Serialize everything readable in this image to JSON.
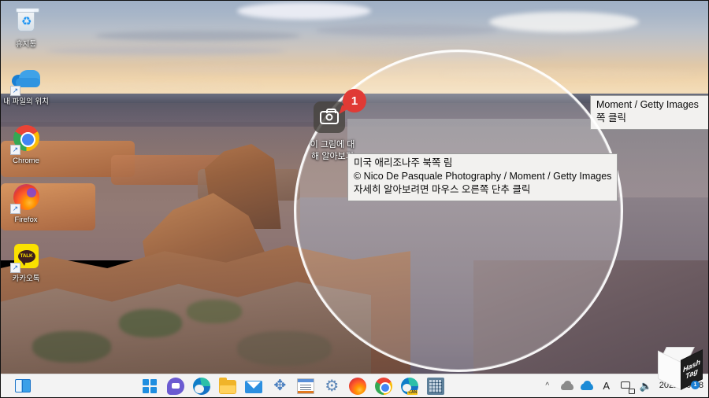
{
  "desktop": {
    "icons": [
      {
        "label": "휴지통",
        "icon": "recycle-bin-icon",
        "name": "desktop-icon-recycle-bin",
        "shortcut": false
      },
      {
        "label": "내 파일의 위치",
        "icon": "onedrive-icon",
        "name": "desktop-icon-onedrive",
        "shortcut": true
      },
      {
        "label": "Chrome",
        "icon": "chrome-icon",
        "name": "desktop-icon-chrome",
        "shortcut": true
      },
      {
        "label": "Firefox",
        "icon": "firefox-icon",
        "name": "desktop-icon-firefox",
        "shortcut": true
      },
      {
        "label": "카카오톡",
        "icon": "kakaotalk-icon",
        "name": "desktop-icon-kakaotalk",
        "shortcut": true
      }
    ],
    "wallpaper_description": "Grand Canyon North Rim at sunset"
  },
  "spotlight": {
    "badge_number": "1",
    "button_icon": "camera-icon",
    "learn_label": "이 그림에 대해 알아보기",
    "highlight_shape": "circle",
    "accent_color": "#e03a35",
    "button_color": "#484440"
  },
  "tooltip": {
    "line1": "미국 애리조나주 북쪽 림",
    "line2": "© Nico De Pasquale Photography / Moment / Getty Images",
    "line3": "자세히 알아보려면 마우스 오른쪽 단추 클릭",
    "bg_color": "#f2f1ef",
    "border_color": "#9b9b9b"
  },
  "tooltip_ghost": {
    "line1": "Moment / Getty Images",
    "line2": "쪽 클릭"
  },
  "taskbar": {
    "bg_color": "#f3f3f3",
    "show_desktop": "show-desktop-icon",
    "apps": [
      {
        "name": "taskbar-start-button",
        "icon": "windows-start-icon",
        "label": "시작"
      },
      {
        "name": "taskbar-teams",
        "icon": "teams-chat-icon",
        "label": "Chat"
      },
      {
        "name": "taskbar-edge",
        "icon": "edge-icon",
        "label": "Microsoft Edge"
      },
      {
        "name": "taskbar-file-explorer",
        "icon": "folder-icon",
        "label": "파일 탐색기"
      },
      {
        "name": "taskbar-mail",
        "icon": "mail-icon",
        "label": "메일"
      },
      {
        "name": "taskbar-move-tool",
        "icon": "move-arrows-icon",
        "label": "이동"
      },
      {
        "name": "taskbar-notepad",
        "icon": "notepad-icon",
        "label": "메모장"
      },
      {
        "name": "taskbar-settings",
        "icon": "gear-icon",
        "label": "설정"
      },
      {
        "name": "taskbar-firefox",
        "icon": "firefox-icon",
        "label": "Firefox"
      },
      {
        "name": "taskbar-chrome",
        "icon": "chrome-icon",
        "label": "Chrome"
      },
      {
        "name": "taskbar-edge-canary",
        "icon": "edge-canary-icon",
        "label": "Edge Canary"
      },
      {
        "name": "taskbar-calculator",
        "icon": "calculator-icon",
        "label": "계산기"
      }
    ],
    "tray": [
      {
        "name": "tray-show-hidden-icons",
        "icon": "chevron-up-icon"
      },
      {
        "name": "tray-onedrive-personal",
        "icon": "cloud-gray-icon"
      },
      {
        "name": "tray-onedrive-business",
        "icon": "cloud-blue-icon"
      },
      {
        "name": "tray-ime-mode",
        "icon": "ime-a-icon",
        "label": "A"
      },
      {
        "name": "tray-network",
        "icon": "network-icon"
      },
      {
        "name": "tray-volume",
        "icon": "speaker-icon",
        "label": "◁))"
      }
    ],
    "clock_date": "2022-06-28"
  },
  "watermark": {
    "line1": "Hash",
    "line2": "Tag",
    "badge": "1"
  }
}
